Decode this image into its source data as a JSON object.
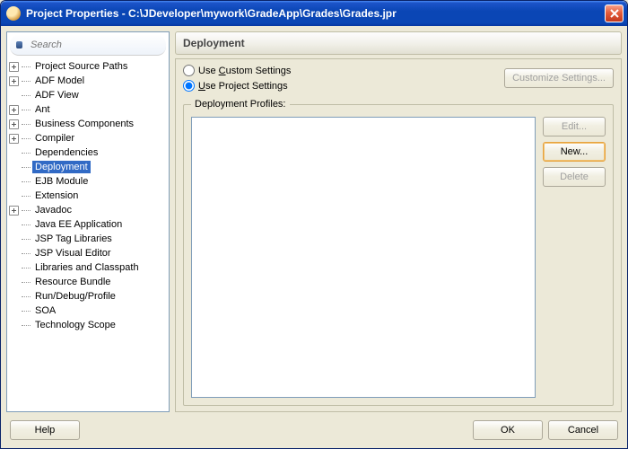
{
  "window": {
    "title": "Project Properties - C:\\JDeveloper\\mywork\\GradeApp\\Grades\\Grades.jpr"
  },
  "search": {
    "placeholder": "Search"
  },
  "tree": {
    "items": [
      {
        "label": "Project Source Paths",
        "expandable": true
      },
      {
        "label": "ADF Model",
        "expandable": true
      },
      {
        "label": "ADF View",
        "expandable": false
      },
      {
        "label": "Ant",
        "expandable": true
      },
      {
        "label": "Business Components",
        "expandable": true
      },
      {
        "label": "Compiler",
        "expandable": true
      },
      {
        "label": "Dependencies",
        "expandable": false
      },
      {
        "label": "Deployment",
        "expandable": false,
        "selected": true
      },
      {
        "label": "EJB Module",
        "expandable": false
      },
      {
        "label": "Extension",
        "expandable": false
      },
      {
        "label": "Javadoc",
        "expandable": true
      },
      {
        "label": "Java EE Application",
        "expandable": false
      },
      {
        "label": "JSP Tag Libraries",
        "expandable": false
      },
      {
        "label": "JSP Visual Editor",
        "expandable": false
      },
      {
        "label": "Libraries and Classpath",
        "expandable": false
      },
      {
        "label": "Resource Bundle",
        "expandable": false
      },
      {
        "label": "Run/Debug/Profile",
        "expandable": false
      },
      {
        "label": "SOA",
        "expandable": false
      },
      {
        "label": "Technology Scope",
        "expandable": false
      }
    ]
  },
  "page": {
    "heading": "Deployment",
    "radio_custom_pre": "Use ",
    "radio_custom_u": "C",
    "radio_custom_post": "ustom Settings",
    "radio_project_pre": "",
    "radio_project_u": "U",
    "radio_project_post": "se Project Settings",
    "customize": "Customize Settings...",
    "group_label": "Deployment Profiles:",
    "edit_pre": "",
    "edit_u": "E",
    "edit_post": "dit...",
    "new_pre": "",
    "new_u": "N",
    "new_post": "ew...",
    "delete_pre": "",
    "delete_u": "D",
    "delete_post": "elete"
  },
  "footer": {
    "help_pre": "",
    "help_u": "H",
    "help_post": "elp",
    "ok": "OK",
    "cancel": "Cancel"
  }
}
